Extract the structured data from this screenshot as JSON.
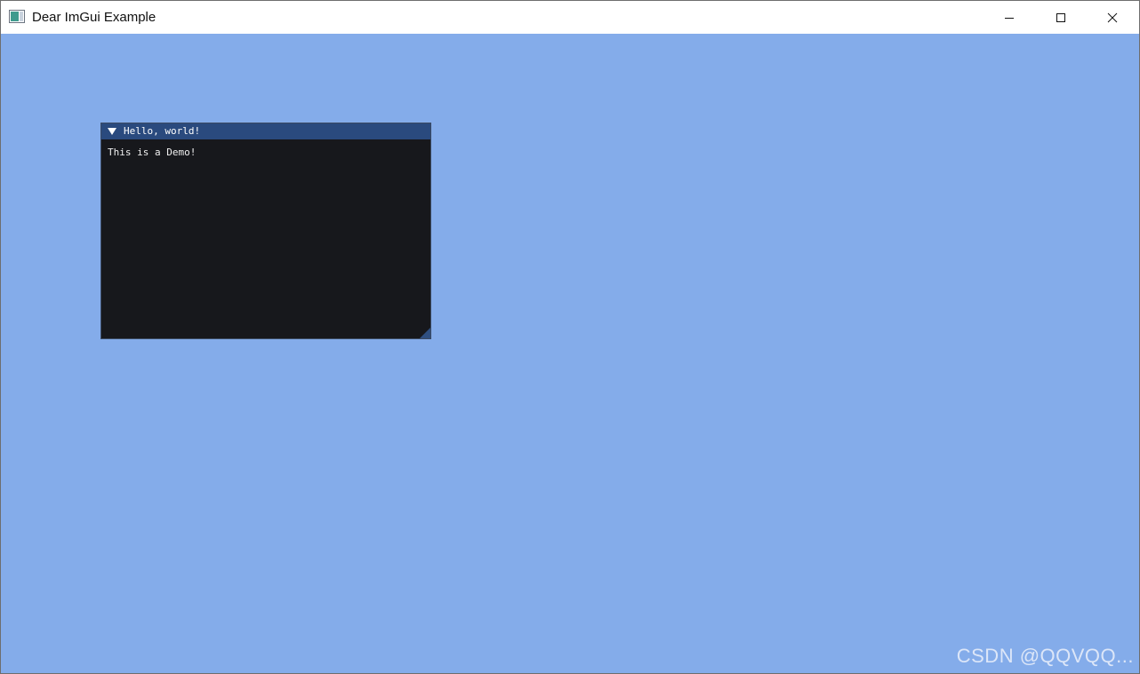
{
  "window": {
    "title": "Dear ImGui Example",
    "controls": {
      "minimize": "minimize",
      "maximize": "maximize",
      "close": "close"
    }
  },
  "imgui_window": {
    "title": "Hello, world!",
    "body_text": "This is a Demo!",
    "collapsed": false
  },
  "watermark": "CSDN @QQVQQ...",
  "colors": {
    "background": "#84acea",
    "imgui_title_bg": "#2a4a7e",
    "imgui_body_bg": "#17181c",
    "titlebar_bg": "#ffffff"
  }
}
